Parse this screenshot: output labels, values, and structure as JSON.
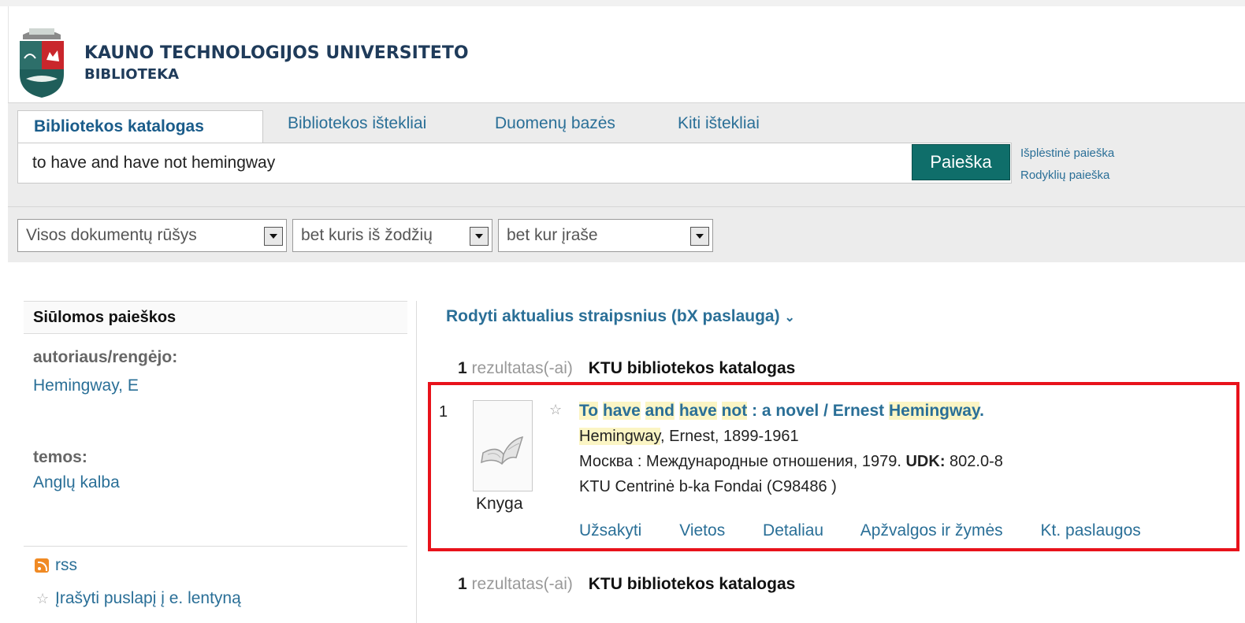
{
  "header": {
    "university": "KAUNO TECHNOLOGIJOS UNIVERSITETO",
    "library": "BIBLIOTEKA"
  },
  "tabs": [
    {
      "label": "Bibliotekos katalogas",
      "active": true
    },
    {
      "label": "Bibliotekos ištekliai",
      "active": false
    },
    {
      "label": "Duomenų bazės",
      "active": false
    },
    {
      "label": "Kiti ištekliai",
      "active": false
    }
  ],
  "search": {
    "query": "to have and have not hemingway",
    "button": "Paieška",
    "advanced": "Išplėstinė paieška",
    "index": "Rodyklių paieška"
  },
  "filters": {
    "doc_type": "Visos dokumentų rūšys",
    "match": "bet kuris iš žodžių",
    "scope": "bet kur įraše"
  },
  "sidebar": {
    "title": "Siūlomos paieškos",
    "author_heading": "autoriaus/rengėjo:",
    "author_link": "Hemingway, E",
    "topics_heading": "temos:",
    "topic_link": "Anglų kalba",
    "rss": "rss",
    "save_page": "Įrašyti puslapį į e. lentyną"
  },
  "results": {
    "bx_link": "Rodyti aktualius straipsnius (bX paslauga)",
    "count": "1",
    "count_label": "rezultatas(-ai)",
    "catalog": "KTU bibliotekos katalogas",
    "items": [
      {
        "index": "1",
        "type": "Knyga",
        "title": "To have and have not : a novel / Ernest Hemingway.",
        "author_hl": "Hemingway",
        "author_rest": ", Ernest, 1899-1961",
        "publication": "Москва : Международные отношения, 1979.",
        "udk_label": "UDK:",
        "udk": "802.0-8",
        "holdings": "KTU Centrinė b-ka Fondai (C98486 )",
        "actions": [
          "Užsakyti",
          "Vietos",
          "Detaliau",
          "Apžvalgos ir žymės",
          "Kt. paslaugos"
        ]
      }
    ]
  },
  "colors": {
    "link": "#2a6f97",
    "button": "#0f6e6a",
    "highlight": "#fbf5c4",
    "selection_border": "#e8121b"
  }
}
